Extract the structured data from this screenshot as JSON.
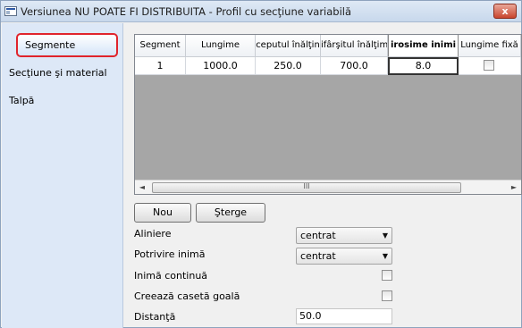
{
  "window": {
    "title": "Versiunea NU POATE FI DISTRIBUITA - Profil cu secţiune variabilă",
    "close_symbol": "x",
    "icon": "app-window-icon"
  },
  "sidebar": {
    "items": [
      {
        "label": "Segmente",
        "selected": true
      },
      {
        "label": "Secţiune şi material",
        "selected": false
      },
      {
        "label": "Talpă",
        "selected": false
      }
    ]
  },
  "grid": {
    "columns": [
      "Segment",
      "Lungime",
      "ceputul înălţin",
      "ifârşitul înălţim",
      "irosime inimi",
      "Lungime fixă"
    ],
    "rows": [
      {
        "segment": "1",
        "lungime": "1000.0",
        "inaltime_start": "250.0",
        "inaltime_end": "700.0",
        "grosime_inima": "8.0",
        "lungime_fixa": false
      }
    ],
    "scrollbar": {
      "left_arrow": "◄",
      "right_arrow": "►",
      "grip": "III"
    }
  },
  "buttons": {
    "add_label": "Nou",
    "delete_label": "Şterge"
  },
  "form": {
    "aliniere": {
      "label": "Aliniere",
      "value": "centrat"
    },
    "potrivire_inima": {
      "label": "Potrivire inimă",
      "value": "centrat"
    },
    "inima_continua": {
      "label": "Inimă continuă",
      "checked": false
    },
    "caseta_goala": {
      "label": "Creează casetă goală",
      "checked": false
    },
    "distanta": {
      "label": "Distanţă",
      "value": "50.0"
    }
  },
  "colors": {
    "selection_outline": "#e0242c",
    "sidebar_bg": "#dde8f7",
    "grid_empty_bg": "#a6a6a6"
  }
}
